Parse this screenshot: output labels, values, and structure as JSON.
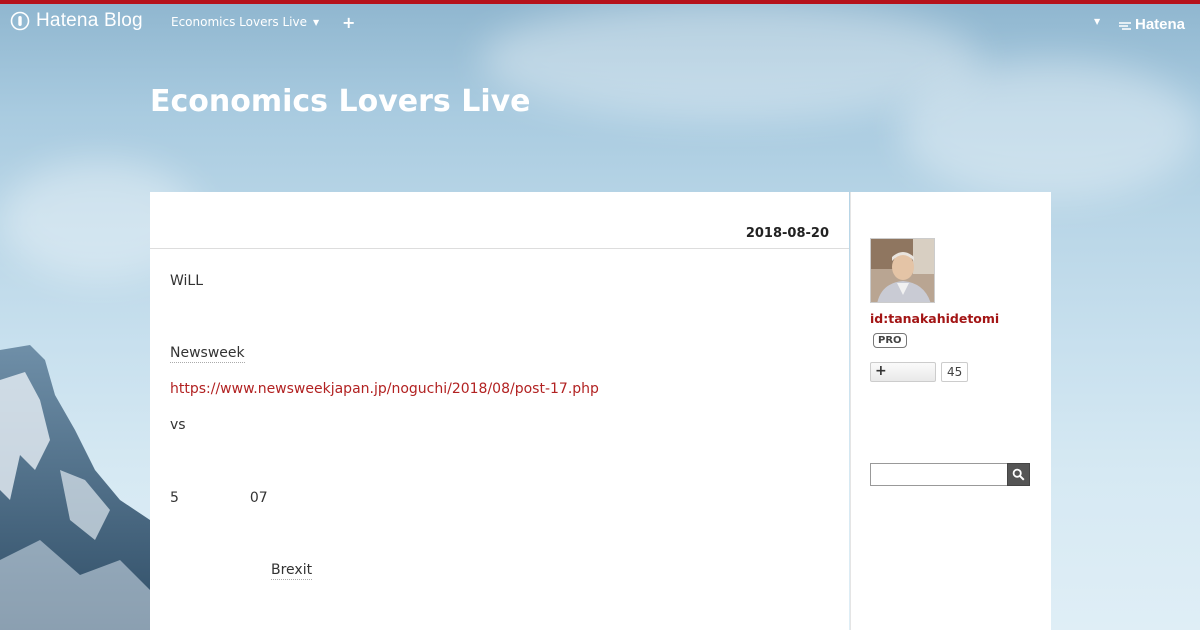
{
  "topbar": {
    "brand": "Hatena Blog",
    "blog_menu": "Economics Lovers Live",
    "plus": "+",
    "hatena": "Hatena"
  },
  "header": {
    "title": "Economics Lovers Live"
  },
  "entry": {
    "date": "2018-08-20",
    "lines": [
      "WiLL",
      "Newsweek",
      "https://www.newsweekjapan.jp/noguchi/2018/08/post-17.php",
      "vs",
      "5",
      "07",
      "Brexit"
    ]
  },
  "sidebar": {
    "profile_id": "id:tanakahidetomi",
    "pro_badge": "PRO",
    "subscribe_icon": "+",
    "subscriber_count": "45",
    "search_value": ""
  },
  "colors": {
    "accent_bar": "#b5121b",
    "link": "#b22222"
  }
}
